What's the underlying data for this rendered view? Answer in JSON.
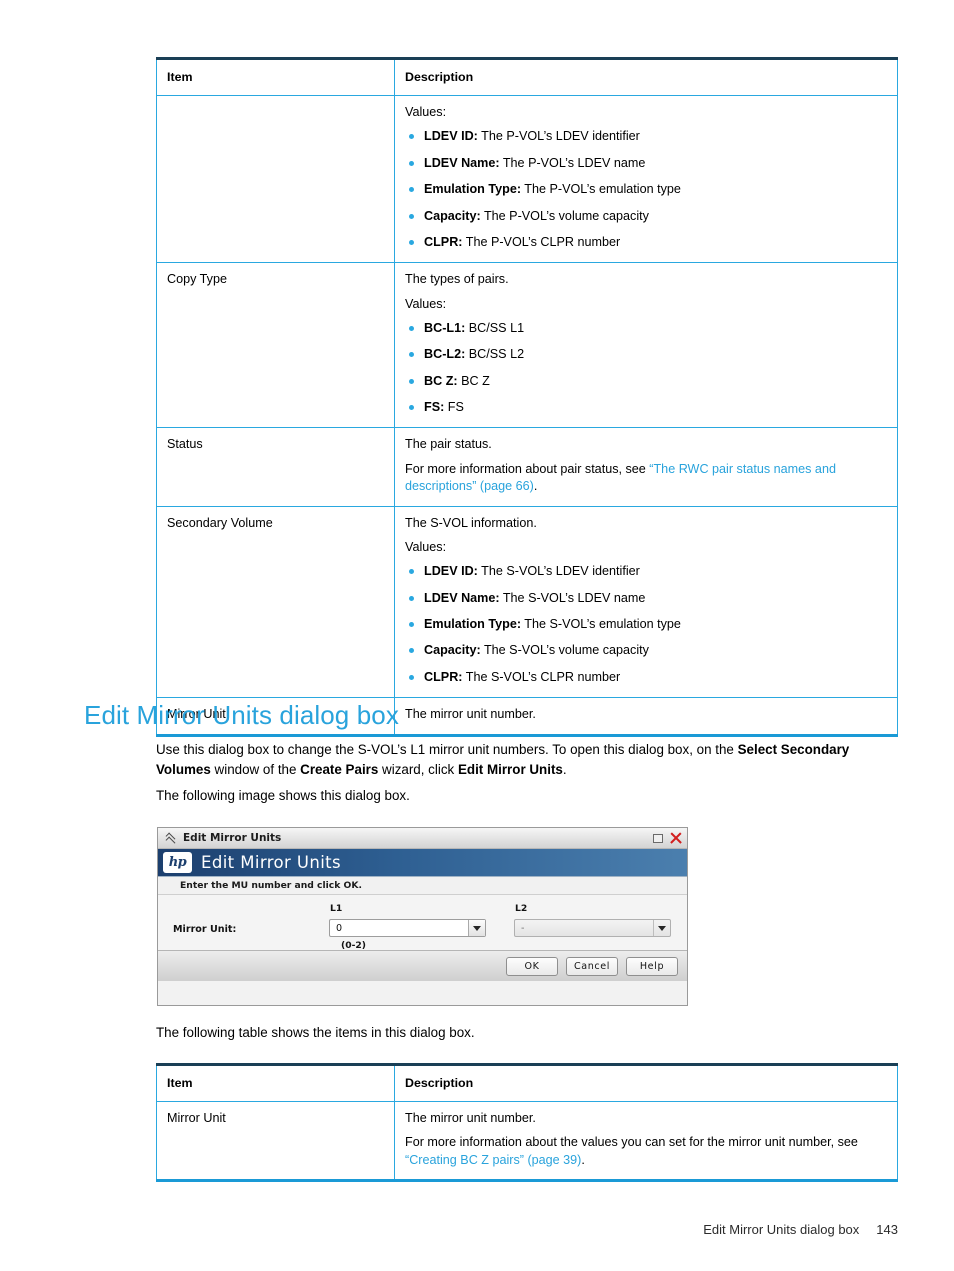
{
  "tables": {
    "top": {
      "headers": {
        "item": "Item",
        "description": "Description"
      },
      "rows": [
        {
          "item": "",
          "intro": "Values:",
          "values": [
            {
              "term": "LDEV ID:",
              "text": " The P-VOL’s LDEV identifier"
            },
            {
              "term": "LDEV Name:",
              "text": " The P-VOL’s LDEV name"
            },
            {
              "term": "Emulation Type:",
              "text": " The P-VOL’s emulation type"
            },
            {
              "term": "Capacity:",
              "text": " The P-VOL’s volume capacity"
            },
            {
              "term": "CLPR:",
              "text": " The P-VOL’s CLPR number"
            }
          ]
        },
        {
          "item": "Copy Type",
          "line1": "The types of pairs.",
          "intro": "Values:",
          "values": [
            {
              "term": "BC-L1:",
              "text": " BC/SS L1"
            },
            {
              "term": "BC-L2:",
              "text": " BC/SS L2"
            },
            {
              "term": "BC Z:",
              "text": " BC Z"
            },
            {
              "term": "FS:",
              "text": " FS"
            }
          ]
        },
        {
          "item": "Status",
          "line1": "The pair status.",
          "link_prefix": "For more information about pair status, see ",
          "link_text": "“The RWC pair status names and descriptions” (page 66)",
          "link_suffix": "."
        },
        {
          "item": "Secondary Volume",
          "line1": "The S-VOL information.",
          "intro": "Values:",
          "values": [
            {
              "term": "LDEV ID:",
              "text": " The S-VOL’s LDEV identifier"
            },
            {
              "term": "LDEV Name:",
              "text": " The S-VOL’s LDEV name"
            },
            {
              "term": "Emulation Type:",
              "text": " The S-VOL’s emulation type"
            },
            {
              "term": "Capacity:",
              "text": " The S-VOL’s volume capacity"
            },
            {
              "term": "CLPR:",
              "text": " The S-VOL’s CLPR number"
            }
          ]
        },
        {
          "item": "Mirror Unit",
          "line1": "The mirror unit number."
        }
      ]
    },
    "bottom": {
      "headers": {
        "item": "Item",
        "description": "Description"
      },
      "row": {
        "item": "Mirror Unit",
        "line1": "The mirror unit number.",
        "link_prefix": "For more information about the values you can set for the mirror unit number, see ",
        "link_text": "“Creating BC Z pairs” (page 39)",
        "link_suffix": "."
      }
    }
  },
  "section": {
    "title": "Edit Mirror Units dialog box",
    "intro_part1": "Use this dialog box to change the S-VOL’s L1 mirror unit numbers. To open this dialog box, on the ",
    "intro_bold1": "Select Secondary Volumes",
    "intro_part2": " window of the ",
    "intro_bold2": "Create Pairs",
    "intro_part3": " wizard, click ",
    "intro_bold3": "Edit Mirror Units",
    "intro_part4": ".",
    "image_caption": "The following image shows this dialog box.",
    "table_caption": "The following table shows the items in this dialog box."
  },
  "dialog": {
    "titlebar_title": "Edit Mirror Units",
    "collapse_icon": "double-chevron-up-icon",
    "maximize_icon": "maximize-icon",
    "close_icon": "close-icon",
    "brand": "hp",
    "banner_title": "Edit Mirror Units",
    "instruction": "Enter the MU number and click OK.",
    "label_l1": "L1",
    "label_l2": "L2",
    "label_mirror_unit": "Mirror Unit:",
    "l1_value": "0",
    "l2_value": "-",
    "range_hint": "(0-2)",
    "buttons": {
      "ok": "OK",
      "cancel": "Cancel",
      "help": "Help"
    }
  },
  "footer": {
    "title": "Edit Mirror Units dialog box",
    "page_number": "143"
  },
  "colors": {
    "accent_blue": "#29a3dc",
    "table_border": "#2aa8e0",
    "table_top_rule": "#1a3f56",
    "banner_dark": "#1c3f6e",
    "close_red": "#d21f1f"
  }
}
